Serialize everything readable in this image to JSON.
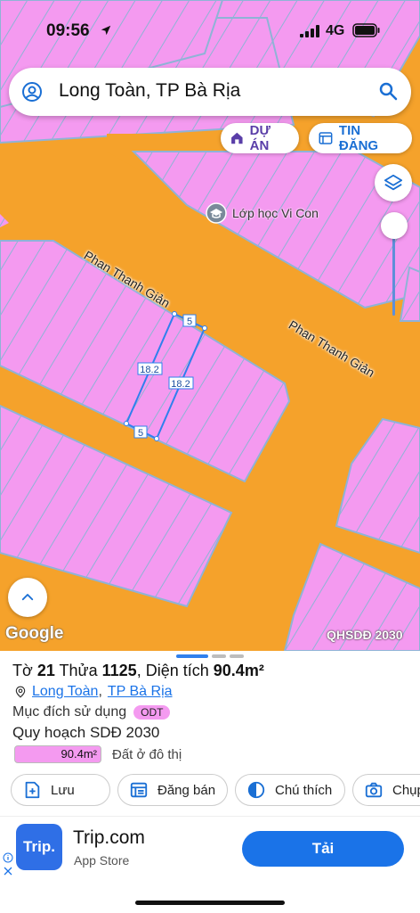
{
  "status_bar": {
    "time": "09:56",
    "network": "4G"
  },
  "search": {
    "text": "Long Toàn, TP Bà Rịa"
  },
  "chips": {
    "project": "DỰ ÁN",
    "listing": "TIN ĐĂNG"
  },
  "map": {
    "poi_label": "Lớp học Vi Con",
    "street_1": "Phan Thanh Giản",
    "street_2": "Phan Thanh Giản",
    "parcel_dims": {
      "top": "5",
      "bottom": "5",
      "left": "18.2",
      "right": "18.2"
    },
    "attribution": "Google",
    "overlay_label": "QHSDĐ 2030",
    "colors": {
      "road": "#f5a22b",
      "residential": "#f49af0",
      "parcel_outline": "#2f80ed"
    }
  },
  "panel": {
    "sheet_label": "Tờ",
    "sheet_no": "21",
    "parcel_label": "Thửa",
    "parcel_no": "1125",
    "area_label": "Diện tích",
    "area_value": "90.4m²",
    "ward": "Long Toàn",
    "city": "TP Bà Rịa",
    "purpose_label": "Mục đích sử dụng",
    "purpose_code": "ODT",
    "plan_title": "Quy hoạch SDĐ 2030",
    "legend_value": "90.4m²",
    "legend_desc": "Đất ở đô thị"
  },
  "actions": {
    "save": "Lưu",
    "post": "Đăng bán",
    "note": "Chú thích",
    "capture": "Chụp"
  },
  "ad": {
    "icon_text": "Trip.",
    "title": "Trip.com",
    "subtitle": "App Store",
    "button": "Tải"
  }
}
